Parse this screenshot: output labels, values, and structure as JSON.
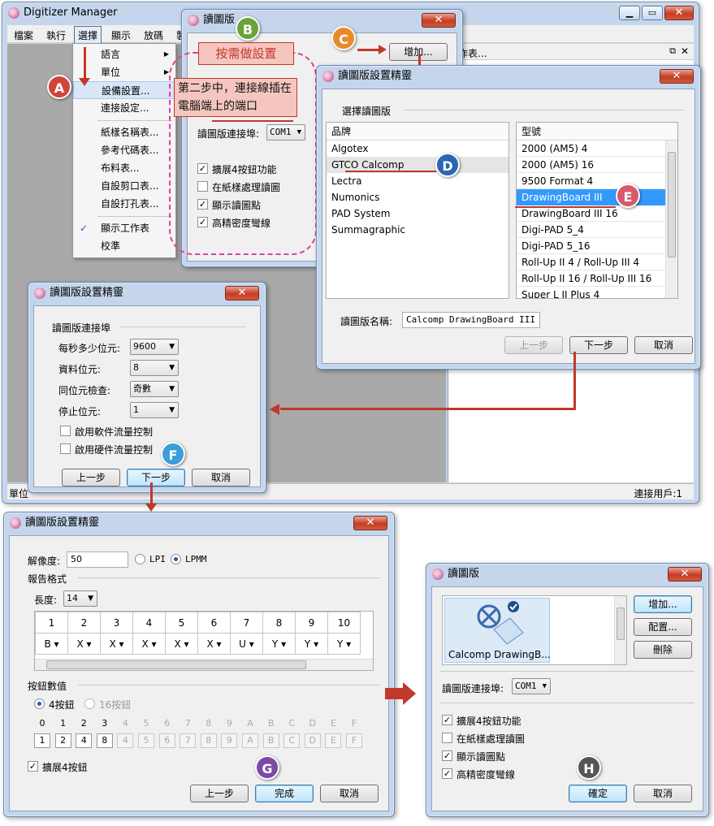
{
  "main": {
    "title": "Digitizer Manager",
    "menu": [
      "檔案",
      "執行",
      "選擇",
      "顯示",
      "放碼"
    ],
    "partial_menu": "製",
    "partial_text": "作表...",
    "status_left": "單位",
    "status_right": "連接用戶:1"
  },
  "dropdown": {
    "items": [
      "語言",
      "單位",
      "設備設置...",
      "連接設定...",
      "紙樣名稱表...",
      "參考代碼表...",
      "布料表...",
      "自設剪口表...",
      "自設打孔表...",
      "顯示工作表",
      "校準"
    ]
  },
  "dlg1": {
    "title": "讀圖版",
    "add_btn": "增加...",
    "port_label": "讀圖版連接埠:",
    "port_value": "COM1",
    "checks": [
      "擴展4按鈕功能",
      "在紙樣處理讀圖",
      "顯示讀圖點",
      "高精密度彎線"
    ]
  },
  "callouts": {
    "b_text": "按需做設置",
    "step2": "第二步中，連接線插在電腦端上的端口"
  },
  "wiz1": {
    "title": "讀圖版設置精靈",
    "group": "選擇讀圖版",
    "brand_header": "品牌",
    "brands": [
      "Algotex",
      "GTCO Calcomp",
      "Lectra",
      "Numonics",
      "PAD System",
      "Summagraphic"
    ],
    "model_header": "型號",
    "models": [
      "2000 (AM5) 4",
      "2000 (AM5) 16",
      "9500 Format 4",
      "DrawingBoard III",
      "DrawingBoard III 16",
      "Digi-PAD 5_4",
      "Digi-PAD 5_16",
      "Roll-Up II 4 / Roll-Up III 4",
      "Roll-Up II 16 / Roll-Up III 16",
      "Super L II Plus 4"
    ],
    "name_label": "讀圖版名稱:",
    "name_value": "Calcomp DrawingBoard III",
    "back": "上一步",
    "next": "下一步",
    "cancel": "取消"
  },
  "wiz2": {
    "title": "讀圖版設置精靈",
    "group": "讀圖版連接埠",
    "baud_label": "每秒多少位元:",
    "baud_value": "9600",
    "data_label": "資料位元:",
    "data_value": "8",
    "parity_label": "同位元檢查:",
    "parity_value": "奇數",
    "stop_label": "停止位元:",
    "stop_value": "1",
    "soft_flow": "啟用軟件流量控制",
    "hard_flow": "啟用硬件流量控制",
    "back": "上一步",
    "next": "下一步",
    "cancel": "取消"
  },
  "wiz3": {
    "title": "讀圖版設置精靈",
    "res_label": "解像度:",
    "res_value": "50",
    "lpi": "LPI",
    "lpmm": "LPMM",
    "report_group": "報告格式",
    "len_label": "長度:",
    "len_value": "14",
    "cols": [
      "1",
      "2",
      "3",
      "4",
      "5",
      "6",
      "7",
      "8",
      "9",
      "10"
    ],
    "vals": [
      "B",
      "X",
      "X",
      "X",
      "X",
      "X",
      "U",
      "Y",
      "Y",
      "Y"
    ],
    "btn_group": "按鈕數值",
    "btn4": "4按鈕",
    "btn16": "16按鈕",
    "hex_labels": [
      "0",
      "1",
      "2",
      "3",
      "4",
      "5",
      "6",
      "7",
      "8",
      "9",
      "A",
      "B",
      "C",
      "D",
      "E",
      "F"
    ],
    "hex_values": [
      "1",
      "2",
      "4",
      "8",
      "4",
      "5",
      "6",
      "7",
      "8",
      "9",
      "A",
      "B",
      "C",
      "D",
      "E",
      "F"
    ],
    "extend": "擴展4按鈕",
    "back": "上一步",
    "finish": "完成",
    "cancel": "取消"
  },
  "dlg2": {
    "title": "讀圖版",
    "device_label": "Calcomp DrawingB...",
    "add": "增加...",
    "config": "配置...",
    "delete": "刪除",
    "port_label": "讀圖版連接埠:",
    "port_value": "COM1",
    "checks": [
      "擴展4按鈕功能",
      "在紙樣處理讀圖",
      "顯示讀圖點",
      "高精密度彎線"
    ],
    "ok": "確定",
    "cancel": "取消"
  },
  "badges": [
    "A",
    "B",
    "C",
    "D",
    "E",
    "F",
    "G",
    "H"
  ]
}
